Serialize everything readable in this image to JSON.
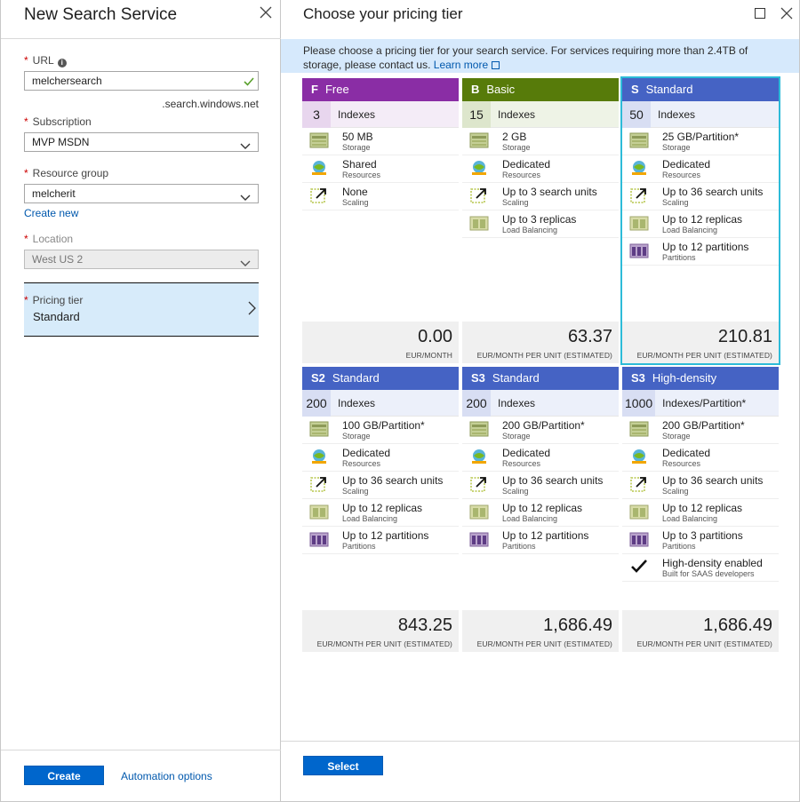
{
  "left": {
    "title": "New Search Service",
    "url": {
      "required": "*",
      "label": "URL",
      "value": "melchersearch",
      "suffix": ".search.windows.net"
    },
    "subscription": {
      "required": "*",
      "label": "Subscription",
      "value": "MVP MSDN"
    },
    "resource_group": {
      "required": "*",
      "label": "Resource group",
      "value": "melcherit",
      "create_new": "Create new"
    },
    "location": {
      "required": "*",
      "label": "Location",
      "value": "West US 2"
    },
    "pricing": {
      "required": "*",
      "label": "Pricing tier",
      "value": "Standard"
    },
    "create_label": "Create",
    "automation_label": "Automation options"
  },
  "right": {
    "title": "Choose your pricing tier",
    "info_text": "Please choose a pricing tier for your search service. For services requiring more than 2.4TB of storage, please contact us.",
    "learn_more": "Learn more",
    "select_label": "Select",
    "tiers": [
      {
        "code": "F",
        "name": "Free",
        "color": "#8a2da5",
        "indexes": "3",
        "indexes_label": "Indexes",
        "features": [
          {
            "icon": "storage-icon",
            "main": "50 MB",
            "sub": "Storage"
          },
          {
            "icon": "resources-icon",
            "main": "Shared",
            "sub": "Resources"
          },
          {
            "icon": "scaling-icon",
            "main": "None",
            "sub": "Scaling"
          }
        ],
        "price": "0.00",
        "price_label": "EUR/MONTH"
      },
      {
        "code": "B",
        "name": "Basic",
        "color": "#577b0a",
        "indexes": "15",
        "indexes_label": "Indexes",
        "features": [
          {
            "icon": "storage-icon",
            "main": "2 GB",
            "sub": "Storage"
          },
          {
            "icon": "resources-icon",
            "main": "Dedicated",
            "sub": "Resources"
          },
          {
            "icon": "scaling-icon",
            "main": "Up to 3 search units",
            "sub": "Scaling"
          },
          {
            "icon": "load-balancing-icon",
            "main": "Up to 3 replicas",
            "sub": "Load Balancing"
          }
        ],
        "price": "63.37",
        "price_label": "EUR/MONTH PER UNIT (ESTIMATED)"
      },
      {
        "code": "S",
        "name": "Standard",
        "color": "#4563c4",
        "selected": true,
        "indexes": "50",
        "indexes_label": "Indexes",
        "features": [
          {
            "icon": "storage-icon",
            "main": "25 GB/Partition*",
            "sub": "Storage"
          },
          {
            "icon": "resources-icon",
            "main": "Dedicated",
            "sub": "Resources"
          },
          {
            "icon": "scaling-icon",
            "main": "Up to 36 search units",
            "sub": "Scaling"
          },
          {
            "icon": "load-balancing-icon",
            "main": "Up to 12 replicas",
            "sub": "Load Balancing"
          },
          {
            "icon": "partitions-icon",
            "main": "Up to 12 partitions",
            "sub": "Partitions"
          }
        ],
        "price": "210.81",
        "price_label": "EUR/MONTH PER UNIT (ESTIMATED)"
      },
      {
        "code": "S2",
        "name": "Standard",
        "color": "#4563c4",
        "indexes": "200",
        "indexes_label": "Indexes",
        "features": [
          {
            "icon": "storage-icon",
            "main": "100 GB/Partition*",
            "sub": "Storage"
          },
          {
            "icon": "resources-icon",
            "main": "Dedicated",
            "sub": "Resources"
          },
          {
            "icon": "scaling-icon",
            "main": "Up to 36 search units",
            "sub": "Scaling"
          },
          {
            "icon": "load-balancing-icon",
            "main": "Up to 12 replicas",
            "sub": "Load Balancing"
          },
          {
            "icon": "partitions-icon",
            "main": "Up to 12 partitions",
            "sub": "Partitions"
          }
        ],
        "price": "843.25",
        "price_label": "EUR/MONTH PER UNIT (ESTIMATED)"
      },
      {
        "code": "S3",
        "name": "Standard",
        "color": "#4563c4",
        "indexes": "200",
        "indexes_label": "Indexes",
        "features": [
          {
            "icon": "storage-icon",
            "main": "200 GB/Partition*",
            "sub": "Storage"
          },
          {
            "icon": "resources-icon",
            "main": "Dedicated",
            "sub": "Resources"
          },
          {
            "icon": "scaling-icon",
            "main": "Up to 36 search units",
            "sub": "Scaling"
          },
          {
            "icon": "load-balancing-icon",
            "main": "Up to 12 replicas",
            "sub": "Load Balancing"
          },
          {
            "icon": "partitions-icon",
            "main": "Up to 12 partitions",
            "sub": "Partitions"
          }
        ],
        "price": "1,686.49",
        "price_label": "EUR/MONTH PER UNIT (ESTIMATED)"
      },
      {
        "code": "S3",
        "name": "High-density",
        "color": "#4563c4",
        "indexes": "1000",
        "indexes_label": "Indexes/Partition*",
        "features": [
          {
            "icon": "storage-icon",
            "main": "200 GB/Partition*",
            "sub": "Storage"
          },
          {
            "icon": "resources-icon",
            "main": "Dedicated",
            "sub": "Resources"
          },
          {
            "icon": "scaling-icon",
            "main": "Up to 36 search units",
            "sub": "Scaling"
          },
          {
            "icon": "load-balancing-icon",
            "main": "Up to 12 replicas",
            "sub": "Load Balancing"
          },
          {
            "icon": "partitions-icon",
            "main": "Up to 3 partitions",
            "sub": "Partitions"
          },
          {
            "icon": "checkmark-icon",
            "main": "High-density enabled",
            "sub": "Built for SAAS developers"
          }
        ],
        "price": "1,686.49",
        "price_label": "EUR/MONTH PER UNIT (ESTIMATED)"
      }
    ]
  }
}
